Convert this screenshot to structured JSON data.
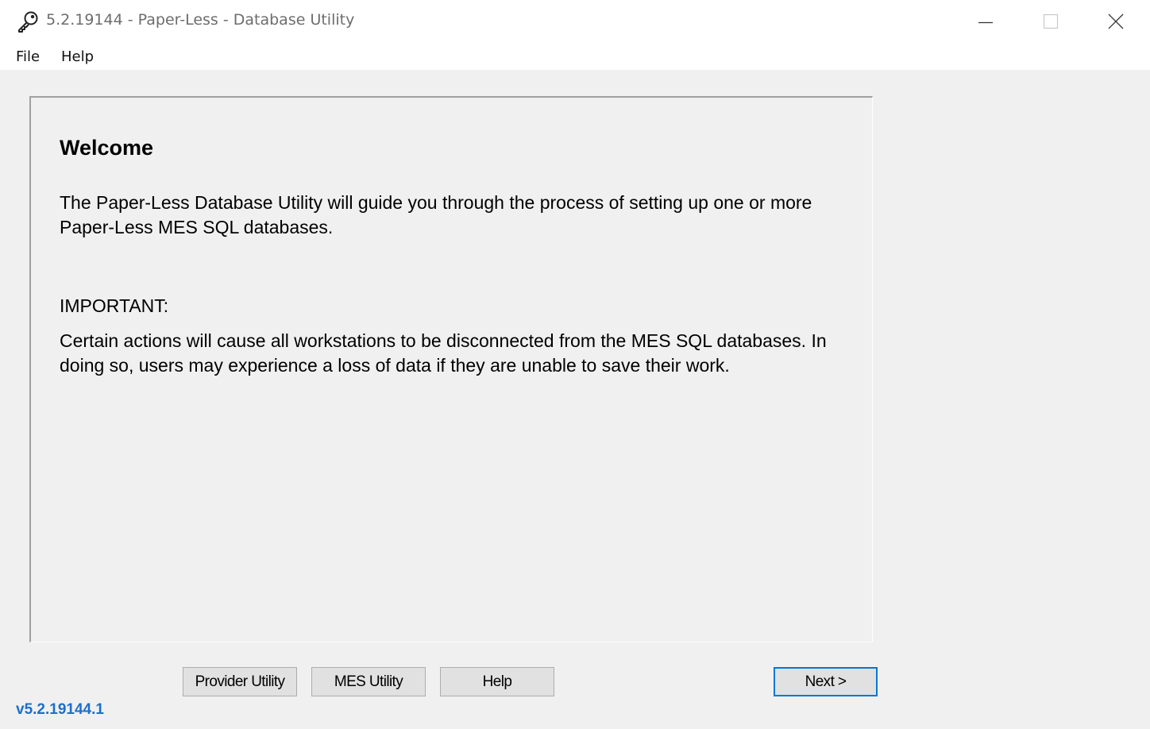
{
  "window": {
    "title": "5.2.19144 - Paper-Less - Database Utility",
    "icon": "key-icon"
  },
  "menu": {
    "items": [
      "File",
      "Help"
    ]
  },
  "welcome": {
    "title": "Welcome",
    "intro": "The Paper-Less Database Utility will guide you through the process of setting up one or more Paper-Less MES SQL databases.",
    "important_label": "IMPORTANT:",
    "warning": "Certain actions will cause all workstations to be disconnected from the MES SQL databases.  In doing so, users may experience a loss of data if they are unable to save their work."
  },
  "buttons": {
    "provider_utility": "Provider Utility",
    "mes_utility": "MES Utility",
    "help": "Help",
    "next": "Next >"
  },
  "version": "v5.2.19144.1",
  "colors": {
    "version_text": "#1d6fc9",
    "focus_border": "#0078d7",
    "window_bg": "#f0f0f0"
  }
}
